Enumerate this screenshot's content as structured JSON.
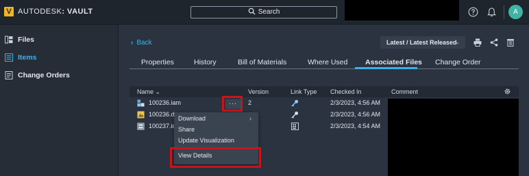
{
  "topbar": {
    "logo_letter": "V",
    "brand_prefix": "AUTODESK",
    "brand_suffix": "VAULT",
    "search_label": "Search",
    "avatar_initial": "A"
  },
  "sidebar": {
    "items": [
      {
        "label": "Files",
        "icon": "files-icon",
        "active": false
      },
      {
        "label": "Items",
        "icon": "items-icon",
        "active": true
      },
      {
        "label": "Change Orders",
        "icon": "change-orders-icon",
        "active": false
      }
    ]
  },
  "main": {
    "back_label": "Back",
    "version_select": "Latest / Latest Released",
    "tabs": [
      "Properties",
      "History",
      "Bill of Materials",
      "Where Used",
      "Associated Files",
      "Change Order"
    ],
    "active_tab": "Associated Files"
  },
  "table": {
    "columns": [
      "Name",
      "Version",
      "Link Type",
      "Checked In",
      "Comment"
    ],
    "rows": [
      {
        "name": "100236.iam",
        "version": "2",
        "link_icon": "key-icon",
        "checked_in": "2/3/2023, 4:56 AM"
      },
      {
        "name": "100236.dv",
        "version": "",
        "link_icon": "key-icon",
        "checked_in": "2/3/2023, 4:56 AM"
      },
      {
        "name": "100237.idv",
        "version": "",
        "link_icon": "grid-doc-icon",
        "checked_in": "2/3/2023, 4:54 AM"
      }
    ]
  },
  "row_actions": {
    "dots_label": "···"
  },
  "context_menu": {
    "items": [
      "Download",
      "Share",
      "Update Visualization",
      "View Details"
    ]
  },
  "colors": {
    "accent": "#3ab4e8",
    "highlight": "#c4161c",
    "logo": "#f0b324",
    "avatar": "#3fb4a3"
  }
}
